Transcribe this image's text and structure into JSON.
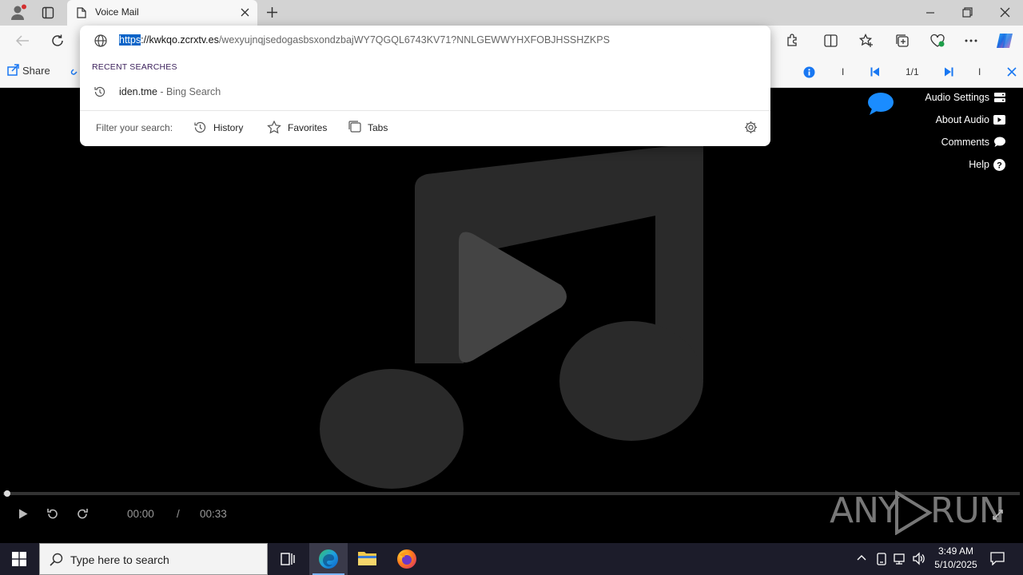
{
  "browser": {
    "tab_title": "Voice Mail",
    "url_scheme": "https",
    "url_sep": "://",
    "url_host": "kwkqo.zcrxtv.es",
    "url_path": "/wexyujnqjsedogasbsxondzbajWY7QGQL6743KV71?NNLGEWWYHXFOBJHSSHZKPS"
  },
  "omnibox": {
    "recent_header": "RECENT SEARCHES",
    "suggestion_main": "iden.tme",
    "suggestion_sub": " - Bing Search",
    "filter_label": "Filter your search:",
    "filters": [
      "History",
      "Favorites",
      "Tabs"
    ]
  },
  "page_toolbar": {
    "share_label": "Share",
    "page_counter": "1/1",
    "separator": "I"
  },
  "player_menu": {
    "items": [
      "Audio Settings",
      "About Audio",
      "Comments",
      "Help"
    ]
  },
  "player": {
    "current_time": "00:00",
    "time_separator": "/",
    "duration": "00:33",
    "progress": 0
  },
  "watermark": {
    "text_left": "ANY",
    "text_right": "RUN"
  },
  "taskbar": {
    "search_placeholder": "Type here to search",
    "time": "3:49 AM",
    "date": "5/10/2025"
  },
  "colors": {
    "accent_blue": "#1877f2",
    "selection": "#0b64c8",
    "chat_bubble": "#1a8cff"
  }
}
